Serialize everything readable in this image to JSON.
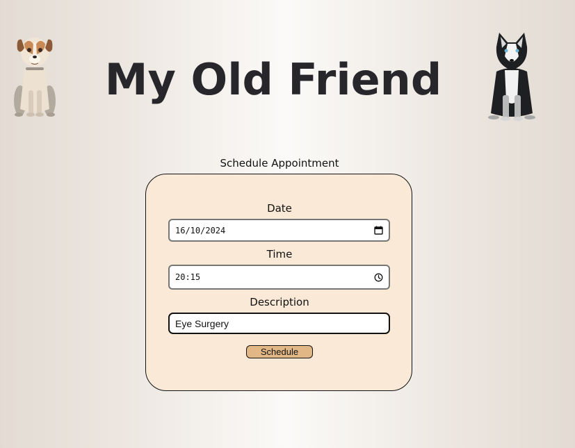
{
  "header": {
    "title": "My Old Friend"
  },
  "section_label": "Schedule Appointment",
  "form": {
    "date": {
      "label": "Date",
      "value": "16/10/2024",
      "icon": "calendar-icon"
    },
    "time": {
      "label": "Time",
      "value": "20:15",
      "icon": "clock-icon"
    },
    "description": {
      "label": "Description",
      "value": "Eye Surgery"
    },
    "submit_label": "Schedule"
  },
  "colors": {
    "card_background": "#f9e9d6",
    "button_background": "#e2b786",
    "title_color": "#26262b"
  }
}
